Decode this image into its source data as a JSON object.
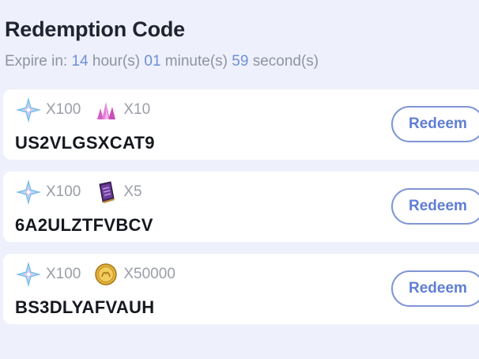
{
  "header": {
    "title": "Redemption Code",
    "expire_prefix": "Expire in:",
    "hours": "14",
    "hours_unit": "hour(s)",
    "minutes": "01",
    "minutes_unit": "minute(s)",
    "seconds": "59",
    "seconds_unit": "second(s)"
  },
  "codes": [
    {
      "rewards": [
        {
          "icon": "star-crystal-icon",
          "qty": "X100"
        },
        {
          "icon": "pink-crystal-icon",
          "qty": "X10"
        }
      ],
      "code": "US2VLGSXCAT9",
      "button_label": "Redeem"
    },
    {
      "rewards": [
        {
          "icon": "star-crystal-icon",
          "qty": "X100"
        },
        {
          "icon": "purple-book-icon",
          "qty": "X5"
        }
      ],
      "code": "6A2ULZTFVBCV",
      "button_label": "Redeem"
    },
    {
      "rewards": [
        {
          "icon": "star-crystal-icon",
          "qty": "X100"
        },
        {
          "icon": "gold-coin-icon",
          "qty": "X50000"
        }
      ],
      "code": "BS3DLYAFVAUH",
      "button_label": "Redeem"
    }
  ],
  "colors": {
    "background": "#eef1fb",
    "accent": "#5f7ed4",
    "countdown": "#6f8ed9"
  }
}
